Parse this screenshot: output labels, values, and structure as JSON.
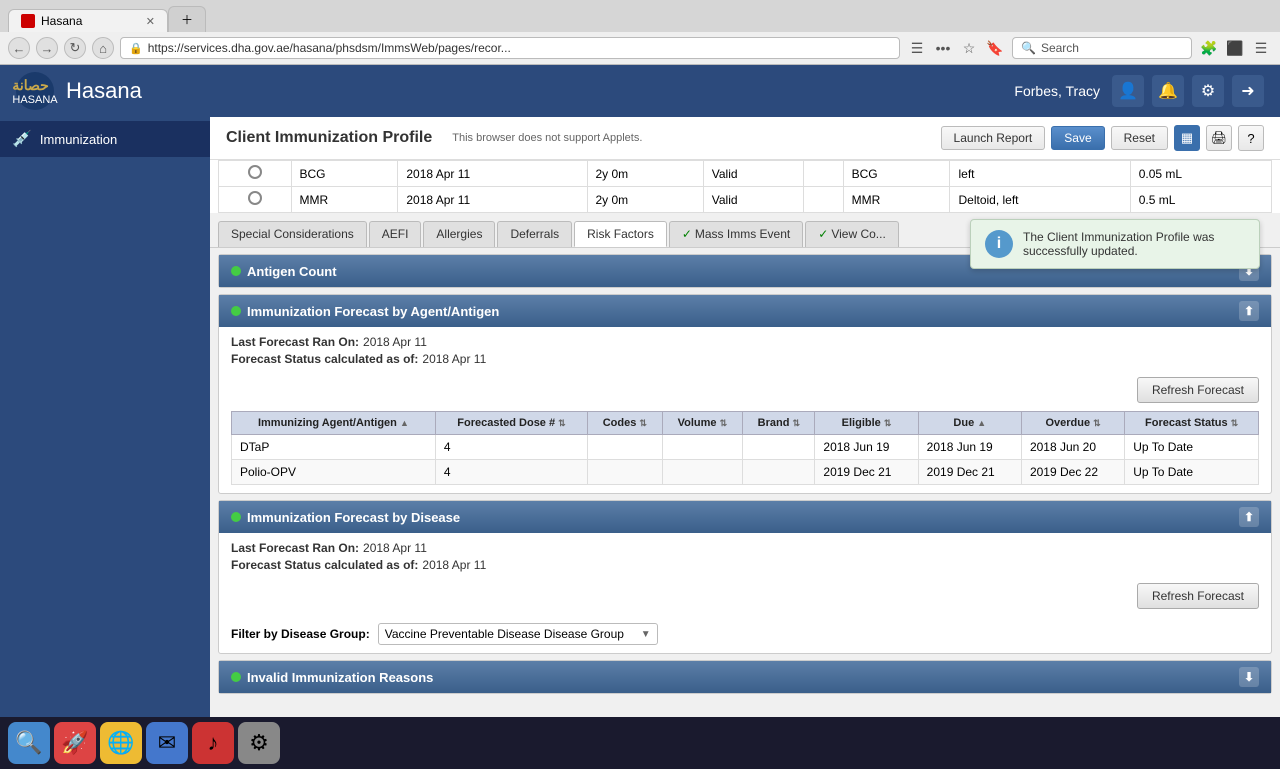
{
  "browser": {
    "tab_label": "Hasana",
    "url": "https://services.dha.gov.ae/hasana/phsdsm/ImmsWeb/pages/recor...",
    "search_placeholder": "Search"
  },
  "header": {
    "logo_ar": "حصانة",
    "logo_en": "HASANA",
    "app_title": "Hasana",
    "user_name": "Forbes, Tracy"
  },
  "sidebar": {
    "item_label": "Immunization",
    "item_icon": "💉"
  },
  "profile": {
    "title": "Client Immunization Profile",
    "subtitle": "This browser does not support Applets.",
    "buttons": {
      "launch_report": "Launch Report",
      "save": "Save",
      "reset": "Reset"
    }
  },
  "records": [
    {
      "vaccine": "BCG",
      "date": "2018 Apr 11",
      "age": "2y 0m",
      "status": "Valid",
      "agent": "BCG",
      "site": "left",
      "dose": "0.05 mL"
    },
    {
      "vaccine": "MMR",
      "date": "2018 Apr 11",
      "age": "2y 0m",
      "status": "Valid",
      "agent": "MMR",
      "site": "Deltoid, left",
      "dose": "0.5 mL"
    }
  ],
  "tabs": [
    {
      "label": "Special Considerations",
      "active": false,
      "check": false
    },
    {
      "label": "AEFI",
      "active": false,
      "check": false
    },
    {
      "label": "Allergies",
      "active": false,
      "check": false
    },
    {
      "label": "Deferrals",
      "active": false,
      "check": false
    },
    {
      "label": "Risk Factors",
      "active": true,
      "check": false
    },
    {
      "label": "Mass Imms Event",
      "active": false,
      "check": true
    },
    {
      "label": "View Co...",
      "active": false,
      "check": true
    }
  ],
  "notification": {
    "text": "The Client Immunization Profile was successfully updated."
  },
  "antigen_count": {
    "section_title": "Antigen Count"
  },
  "forecast_agent": {
    "section_title": "Immunization Forecast by Agent/Antigen",
    "last_forecast_label": "Last Forecast Ran On:",
    "last_forecast_value": "2018 Apr 11",
    "status_label": "Forecast Status calculated as of:",
    "status_value": "2018 Apr 11",
    "refresh_btn": "Refresh Forecast",
    "columns": {
      "agent": "Immunizing Agent/Antigen",
      "dose": "Forecasted Dose #",
      "codes": "Codes",
      "volume": "Volume",
      "brand": "Brand",
      "eligible": "Eligible",
      "due": "Due",
      "overdue": "Overdue",
      "status": "Forecast Status"
    },
    "rows": [
      {
        "agent": "DTaP",
        "dose": "4",
        "codes": "",
        "volume": "",
        "brand": "",
        "eligible": "2018 Jun 19",
        "due": "2018 Jun 19",
        "overdue": "2018 Jun 20",
        "status": "Up To Date"
      },
      {
        "agent": "Polio-OPV",
        "dose": "4",
        "codes": "",
        "volume": "",
        "brand": "",
        "eligible": "2019 Dec 21",
        "due": "2019 Dec 21",
        "overdue": "2019 Dec 22",
        "status": "Up To Date"
      }
    ]
  },
  "forecast_disease": {
    "section_title": "Immunization Forecast by Disease",
    "last_forecast_label": "Last Forecast Ran On:",
    "last_forecast_value": "2018 Apr 11",
    "status_label": "Forecast Status calculated as of:",
    "status_value": "2018 Apr 11",
    "refresh_btn": "Refresh Forecast",
    "filter_label": "Filter by Disease Group:",
    "filter_value": "Vaccine Preventable Disease Disease Group"
  },
  "invalid_section": {
    "section_title": "Invalid Immunization Reasons"
  }
}
